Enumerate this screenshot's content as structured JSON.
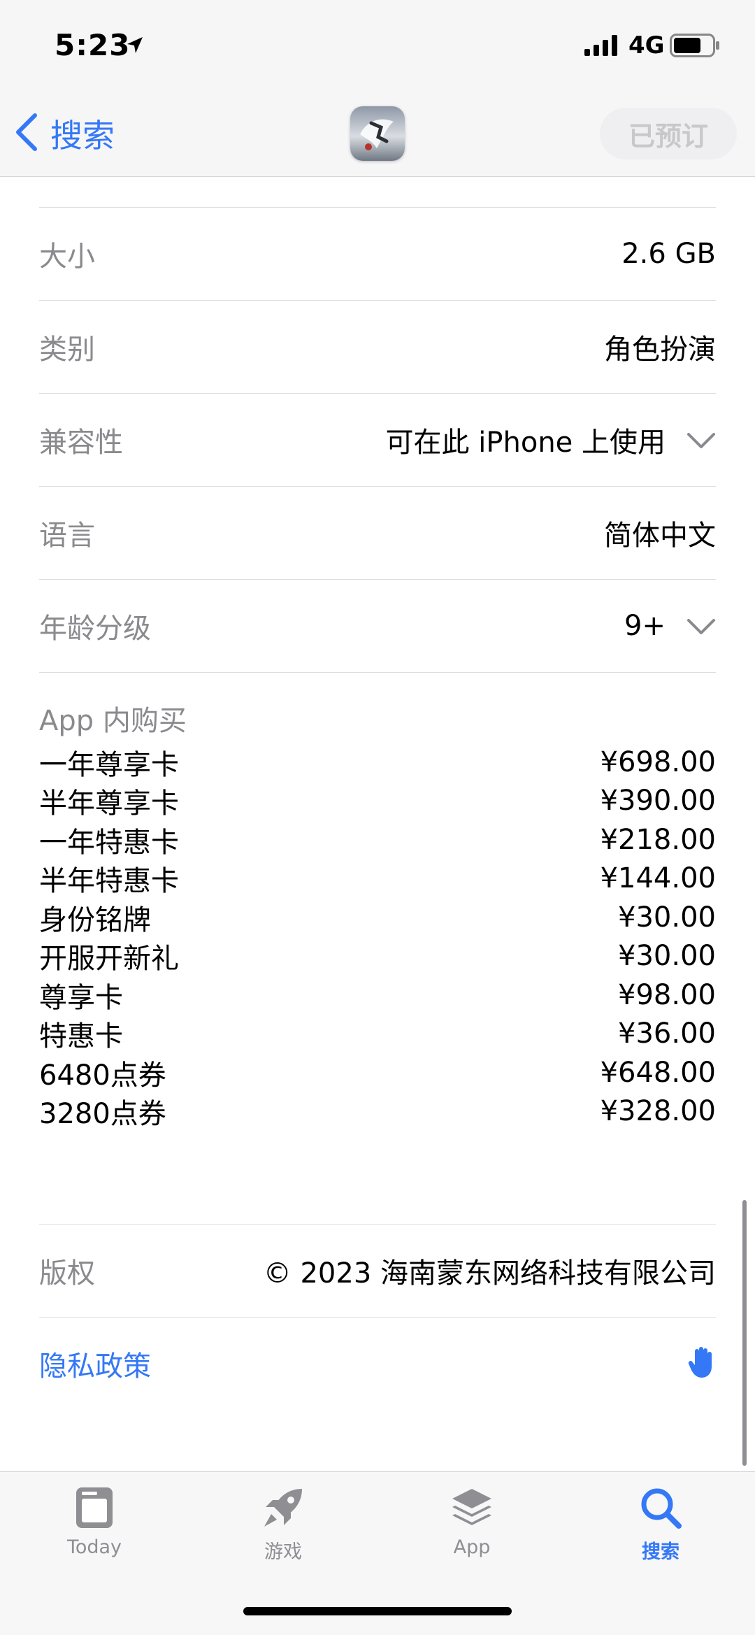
{
  "status_bar": {
    "time": "5:23",
    "network": "4G"
  },
  "nav": {
    "back_label": "搜索",
    "preorder_label": "已预订"
  },
  "info_rows": [
    {
      "key": "大小",
      "value": "2.6 GB"
    },
    {
      "key": "类别",
      "value": "角色扮演"
    },
    {
      "key": "兼容性",
      "value": "可在此 iPhone 上使用"
    },
    {
      "key": "语言",
      "value": "简体中文"
    },
    {
      "key": "年龄分级",
      "value": "9+"
    }
  ],
  "iap": {
    "title": "App 内购买",
    "items": [
      {
        "name": "一年尊享卡",
        "price": "¥698.00"
      },
      {
        "name": "半年尊享卡",
        "price": "¥390.00"
      },
      {
        "name": "一年特惠卡",
        "price": "¥218.00"
      },
      {
        "name": "半年特惠卡",
        "price": "¥144.00"
      },
      {
        "name": "身份铭牌",
        "price": "¥30.00"
      },
      {
        "name": "开服开新礼",
        "price": "¥30.00"
      },
      {
        "name": "尊享卡",
        "price": "¥98.00"
      },
      {
        "name": "特惠卡",
        "price": "¥36.00"
      },
      {
        "name": "6480点券",
        "price": "¥648.00"
      },
      {
        "name": "3280点券",
        "price": "¥328.00"
      }
    ]
  },
  "copyright": {
    "key": "版权",
    "value": "© 2023 海南蒙东网络科技有限公司"
  },
  "privacy": {
    "label": "隐私政策"
  },
  "tabs": [
    {
      "label": "Today",
      "icon": "today-icon"
    },
    {
      "label": "游戏",
      "icon": "rocket-icon"
    },
    {
      "label": "App",
      "icon": "layers-icon"
    },
    {
      "label": "搜索",
      "icon": "search-icon",
      "active": true
    }
  ],
  "colors": {
    "accent": "#3478f6",
    "secondary_text": "#8a8a8e",
    "inactive_tab": "#8e8e93"
  }
}
